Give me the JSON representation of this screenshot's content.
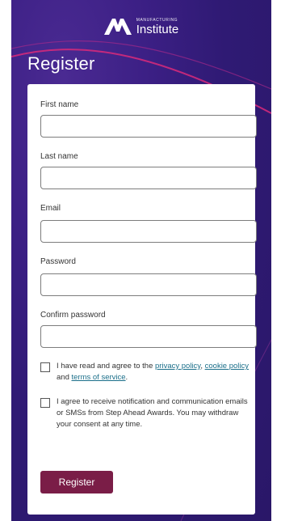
{
  "brand": {
    "name_small": "MANUFACTURING",
    "name_big": "Institute"
  },
  "page": {
    "title": "Register"
  },
  "form": {
    "fields": [
      {
        "label": "First name",
        "value": "",
        "placeholder": ""
      },
      {
        "label": "Last name",
        "value": "",
        "placeholder": ""
      },
      {
        "label": "Email",
        "value": "",
        "placeholder": ""
      },
      {
        "label": "Password",
        "value": "",
        "placeholder": ""
      },
      {
        "label": "Confirm password",
        "value": "",
        "placeholder": ""
      }
    ],
    "consent_terms": {
      "text_before": "I have read and agree to the",
      "privacy_link": "privacy policy",
      "comma": ",",
      "cookie_link": "cookie policy",
      "and_text": "and",
      "terms_link": "terms of service",
      "period": ".",
      "checked": false
    },
    "consent_notifications": {
      "text": "I agree to receive notification and communication emails or SMSs from Step Ahead Awards. You may withdraw your consent at any time.",
      "checked": false
    },
    "submit_label": "Register"
  },
  "colors": {
    "background": "#2f1a74",
    "accent_curve": "#d92a7a",
    "button": "#7a1d47",
    "link": "#1b6f8a"
  }
}
